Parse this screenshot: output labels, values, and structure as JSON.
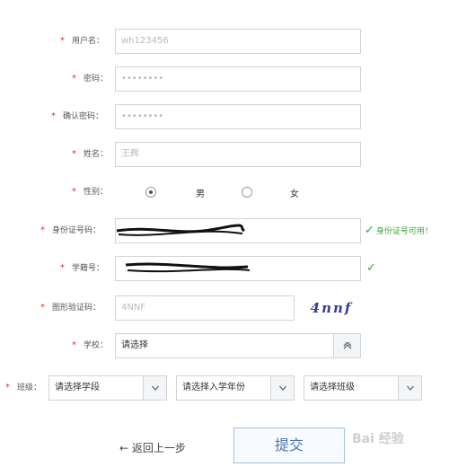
{
  "form": {
    "required_mark": "*",
    "username": {
      "label": "用户名：",
      "value": "wh123456"
    },
    "password": {
      "label": "密码：",
      "value": "••••••••"
    },
    "confirm_password": {
      "label": "确认密码：",
      "value": "••••••••"
    },
    "name": {
      "label": "姓名：",
      "value": "王辉"
    },
    "gender": {
      "label": "性别：",
      "options": [
        "男",
        "女"
      ],
      "selected": "男"
    },
    "id_number": {
      "label": "身份证号码：",
      "value": "",
      "ok_text": "身份证号可用！"
    },
    "student_no": {
      "label": "学籍号：",
      "value": ""
    },
    "captcha": {
      "label": "图形验证码：",
      "value": "4NNF",
      "image_text": "4nnf"
    },
    "school": {
      "label": "学校：",
      "value": "请选择"
    },
    "class": {
      "label": "班级：",
      "selects": [
        "请选择学段",
        "请选择入学年份",
        "请选择班级"
      ]
    }
  },
  "actions": {
    "back_label": "返回上一步",
    "submit_label": "提交"
  },
  "watermark": "Bai 经验",
  "colors": {
    "required": "#e0312c",
    "success": "#37a53b",
    "submit_text": "#4a76b0"
  }
}
